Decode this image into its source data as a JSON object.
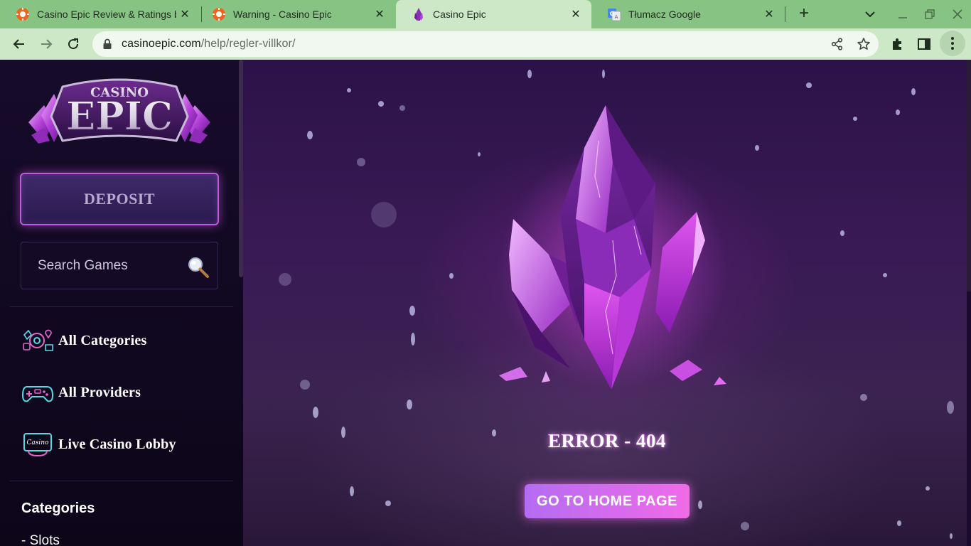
{
  "browser": {
    "tabs": [
      {
        "title": "Casino Epic Review & Ratings by",
        "active": false,
        "icon": "orange-chip-icon"
      },
      {
        "title": "Warning - Casino Epic",
        "active": false,
        "icon": "orange-chip-icon"
      },
      {
        "title": "Casino Epic",
        "active": true,
        "icon": "purple-crystal-icon"
      },
      {
        "title": "Tłumacz Google",
        "active": false,
        "icon": "google-translate-icon"
      }
    ],
    "url": {
      "domain": "casinoepic.com",
      "path": "/help/regler-villkor/"
    },
    "colors": {
      "frame": "#87c382",
      "toolbar": "#cce8c6",
      "omnibox": "#f1f8ef"
    }
  },
  "sidebar": {
    "logo": {
      "top": "CASINO",
      "main": "EPIC"
    },
    "deposit_label": "DEPOSIT",
    "search": {
      "placeholder": "Search Games"
    },
    "nav": [
      {
        "label": "All Categories",
        "icon": "categories-icon"
      },
      {
        "label": "All Providers",
        "icon": "gamepad-icon"
      },
      {
        "label": "Live Casino Lobby",
        "icon": "live-casino-icon",
        "icon_text": "Casino"
      }
    ],
    "categories_heading": "Categories",
    "categories": [
      "- Slots"
    ]
  },
  "main": {
    "error_text": "ERROR - 404",
    "home_button": "GO TO HOME PAGE",
    "colors": {
      "accent_start": "#b46cf2",
      "accent_end": "#f06be8",
      "crystal": "#c23fd6"
    }
  }
}
